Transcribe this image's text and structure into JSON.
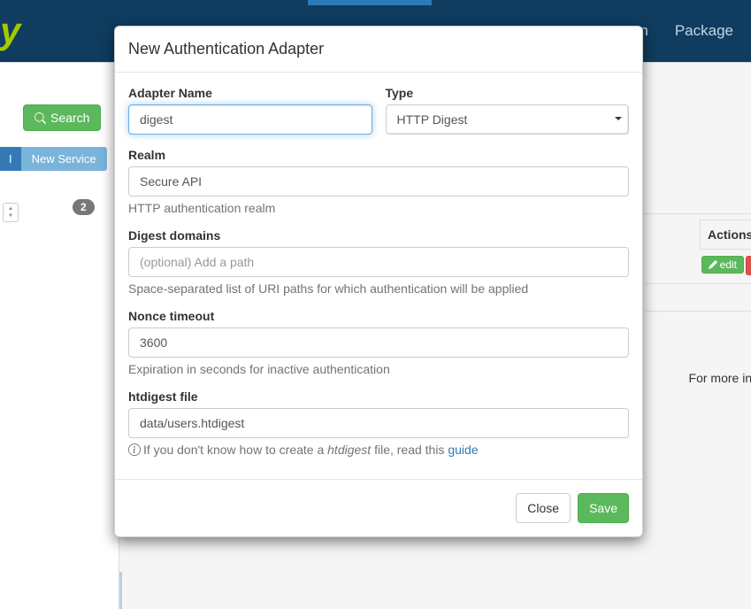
{
  "navbar": {
    "logo_fragment": "y",
    "nav_item_frag1": "n",
    "nav_item_package": "Package"
  },
  "bg": {
    "search_button": "Search",
    "pill_api": "I",
    "pill_new_service": "New Service",
    "badge_count": "2",
    "th_actions": "Actions",
    "edit_label": "edit",
    "more_info": "For more inf"
  },
  "modal": {
    "title": "New Authentication Adapter",
    "adapter_name": {
      "label": "Adapter Name",
      "value": "digest"
    },
    "type": {
      "label": "Type",
      "selected": "HTTP Digest"
    },
    "realm": {
      "label": "Realm",
      "value": "Secure API",
      "help": "HTTP authentication realm"
    },
    "digest_domains": {
      "label": "Digest domains",
      "value": "",
      "placeholder": "(optional) Add a path",
      "help": "Space-separated list of URI paths for which authentication will be applied"
    },
    "nonce_timeout": {
      "label": "Nonce timeout",
      "value": "3600",
      "help": "Expiration in seconds for inactive authentication"
    },
    "htdigest": {
      "label": "htdigest file",
      "value": "data/users.htdigest",
      "help_prefix": "If you don't know how to create a ",
      "help_em": "htdigest",
      "help_suffix": " file, read this ",
      "help_link": "guide"
    },
    "footer": {
      "close": "Close",
      "save": "Save"
    }
  }
}
